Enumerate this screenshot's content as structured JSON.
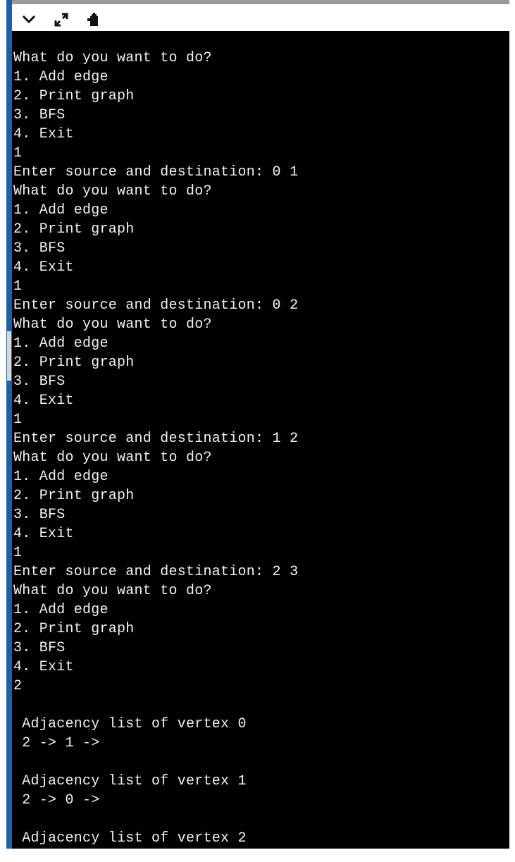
{
  "toolbar": {
    "icons": [
      "chevron-down-icon",
      "expand-icon",
      "clipboard-icon"
    ]
  },
  "console": {
    "lines": [
      "What do you want to do?",
      "1. Add edge",
      "2. Print graph",
      "3. BFS",
      "4. Exit",
      "1",
      "Enter source and destination: 0 1",
      "What do you want to do?",
      "1. Add edge",
      "2. Print graph",
      "3. BFS",
      "4. Exit",
      "1",
      "Enter source and destination: 0 2",
      "What do you want to do?",
      "1. Add edge",
      "2. Print graph",
      "3. BFS",
      "4. Exit",
      "1",
      "Enter source and destination: 1 2",
      "What do you want to do?",
      "1. Add edge",
      "2. Print graph",
      "3. BFS",
      "4. Exit",
      "1",
      "Enter source and destination: 2 3",
      "What do you want to do?",
      "1. Add edge",
      "2. Print graph",
      "3. BFS",
      "4. Exit",
      "2",
      "",
      " Adjacency list of vertex 0",
      " 2 -> 1 ->",
      "",
      " Adjacency list of vertex 1",
      " 2 -> 0 ->",
      "",
      " Adjacency list of vertex 2"
    ]
  },
  "colors": {
    "terminal_background": "#000000",
    "terminal_text": "#f2f2f2",
    "left_rail": "#1f5fa8"
  }
}
